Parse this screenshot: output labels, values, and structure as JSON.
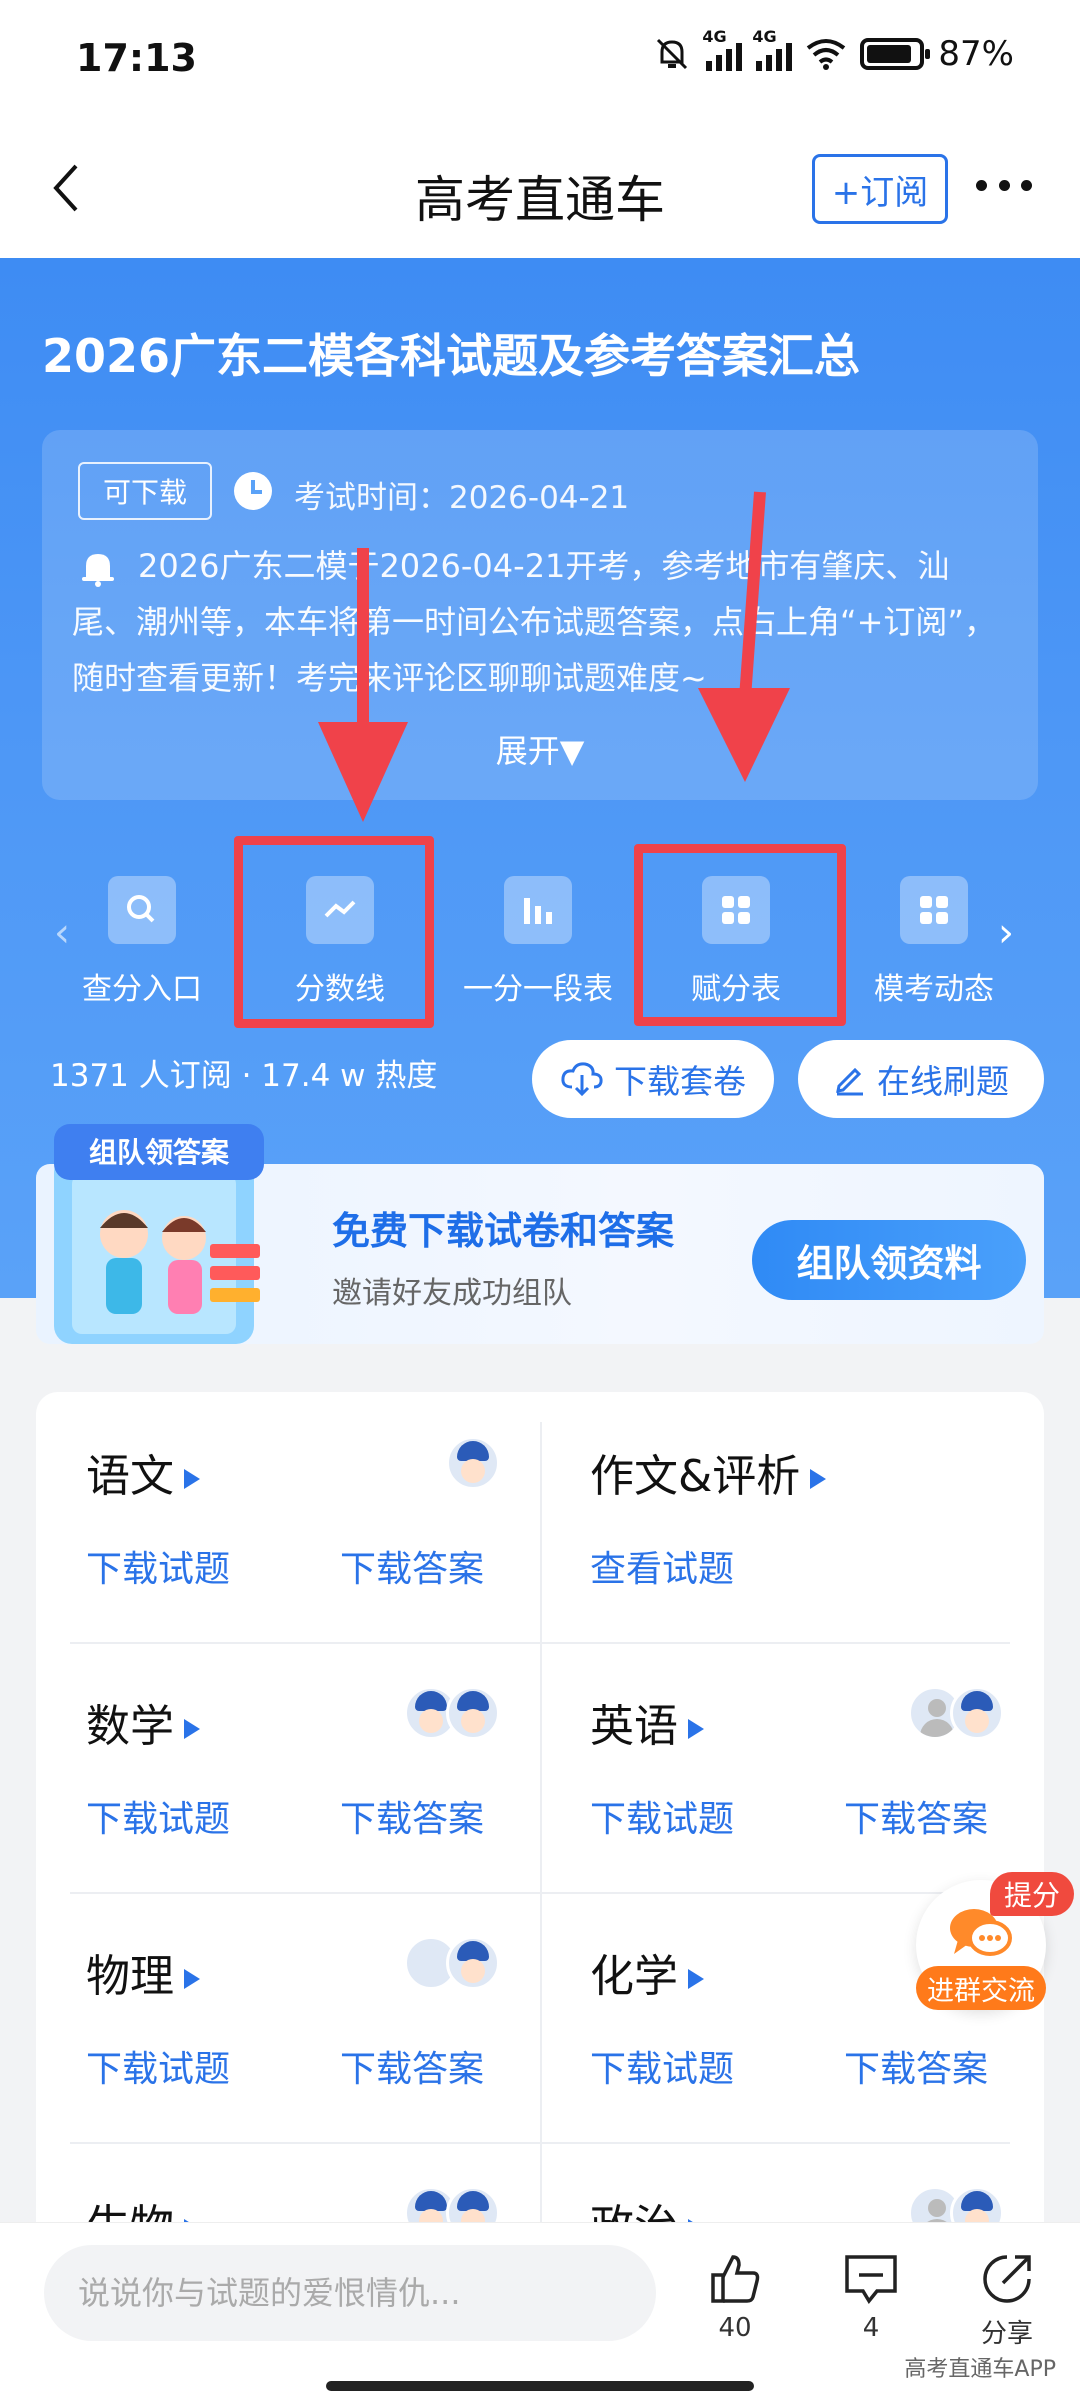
{
  "status": {
    "time": "17:13",
    "signal_label": "4G",
    "battery": "87%"
  },
  "nav": {
    "title": "高考直通车",
    "subscribe": "+订阅"
  },
  "hero": {
    "title": "2026广东二模各科试题及参考答案汇总",
    "tag": "可下载",
    "exam_time": "考试时间：2026-04-21",
    "notice": "2026广东二模于2026-04-21开考，参考地市有肇庆、汕尾、潮州等，本车将第一时间公布试题答案，点右上角“+订阅”，随时查看更新！考完来评论区聊聊试题难度~",
    "expand": "展开▼"
  },
  "quick": [
    {
      "label": "查分入口",
      "icon": "search-icon"
    },
    {
      "label": "分数线",
      "icon": "trend-icon"
    },
    {
      "label": "一分一段表",
      "icon": "bar-chart-icon"
    },
    {
      "label": "赋分表",
      "icon": "grid-icon"
    },
    {
      "label": "模考动态",
      "icon": "grid-icon"
    }
  ],
  "stats": "1371 人订阅 · 17.4 w 热度",
  "buttons": {
    "download_set": "下载套卷",
    "online_practice": "在线刷题"
  },
  "banner": {
    "art_title": "组队领答案",
    "title": "免费下载试卷和答案",
    "subtitle": "邀请好友成功组队",
    "button": "组队领资料"
  },
  "subjects": [
    {
      "name": "语文",
      "links": [
        "下载试题",
        "下载答案"
      ]
    },
    {
      "name": "作文&评析",
      "links": [
        "查看试题"
      ]
    },
    {
      "name": "数学",
      "links": [
        "下载试题",
        "下载答案"
      ]
    },
    {
      "name": "英语",
      "links": [
        "下载试题",
        "下载答案"
      ]
    },
    {
      "name": "物理",
      "links": [
        "下载试题",
        "下载答案"
      ]
    },
    {
      "name": "化学",
      "links": [
        "下载试题",
        "下载答案"
      ]
    },
    {
      "name": "生物",
      "links": []
    },
    {
      "name": "政治",
      "links": []
    }
  ],
  "float": {
    "badge": "提分",
    "button": "进群交流"
  },
  "bottom": {
    "placeholder": "说说你与试题的爱恨情仇...",
    "likes": "40",
    "comments": "4",
    "share": "分享",
    "watermark": "高考直通车APP"
  },
  "colors": {
    "primary": "#2a73e8",
    "highlight": "#f0424a",
    "hero_bg": "#4d97f6"
  }
}
